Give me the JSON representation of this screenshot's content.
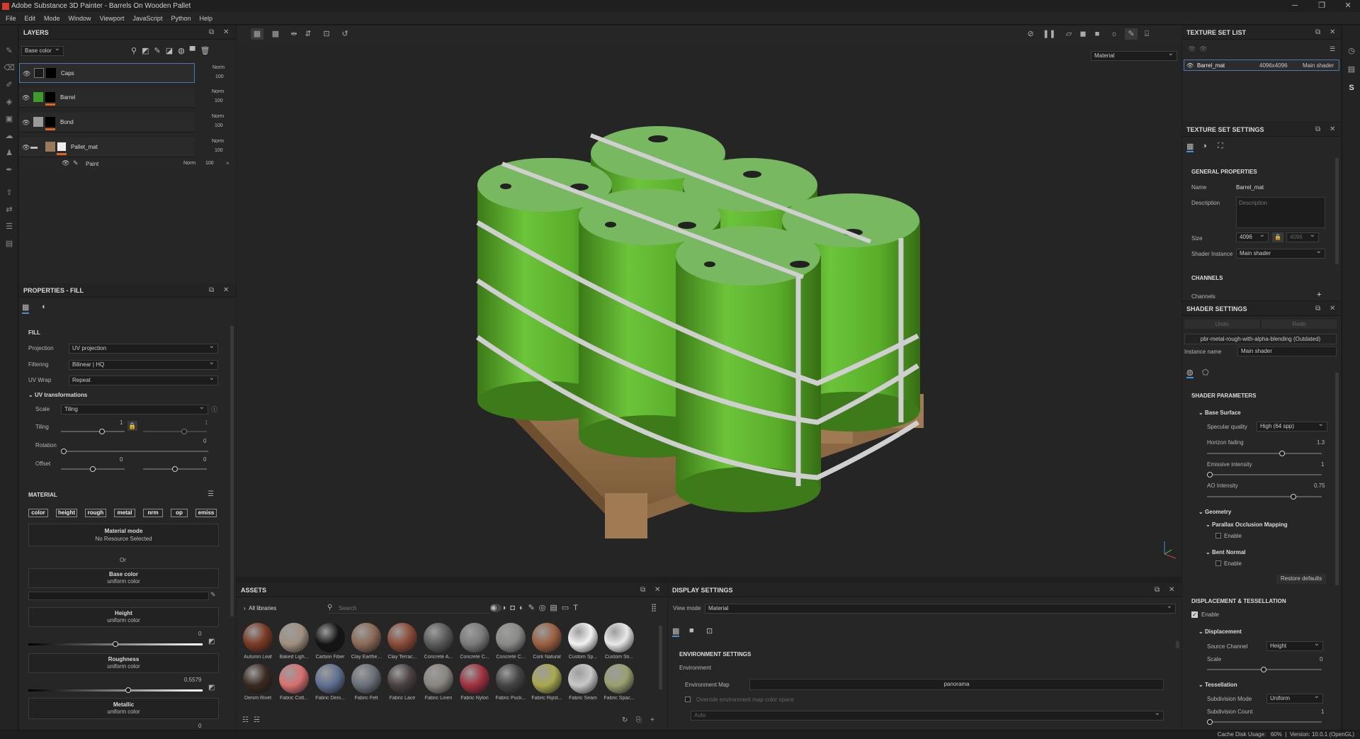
{
  "window": {
    "title": "Adobe Substance 3D Painter - Barrels On Wooden Pallet",
    "minimize": "─",
    "maximize": "❐",
    "close": "✕"
  },
  "menu": [
    "File",
    "Edit",
    "Mode",
    "Window",
    "Viewport",
    "JavaScript",
    "Python",
    "Help"
  ],
  "layers": {
    "title": "LAYERS",
    "channel": "Base color",
    "items": [
      {
        "name": "Caps",
        "blend": "Norm",
        "opacity": "100"
      },
      {
        "name": "Barrel",
        "blend": "Norm",
        "opacity": "100"
      },
      {
        "name": "Bond",
        "blend": "Norm",
        "opacity": "100"
      },
      {
        "name": "Pallet_mat",
        "blend": "Norm",
        "opacity": "100"
      }
    ],
    "sub": {
      "name": "Paint",
      "blend": "Norm",
      "opacity": "100"
    }
  },
  "properties": {
    "title": "PROPERTIES - FILL",
    "fill": "FILL",
    "projection_label": "Projection",
    "projection": "UV projection",
    "filtering_label": "Filtering",
    "filtering": "Bilinear | HQ",
    "uvwrap_label": "UV Wrap",
    "uvwrap": "Repeat",
    "uvt": "UV transformations",
    "scale_label": "Scale",
    "scale": "Tiling",
    "tiling_label": "Tiling",
    "tiling_val": "1",
    "tiling_val2": "1",
    "rotation_label": "Rotation",
    "rotation_val": "0",
    "offset_label": "Offset",
    "offset_val1": "0",
    "offset_val2": "0",
    "material": "MATERIAL",
    "chips": [
      "color",
      "height",
      "rough",
      "metal",
      "nrm",
      "op",
      "emiss"
    ],
    "mat_mode": "Material mode",
    "mat_mode_sub": "No Resource Selected",
    "or": "Or",
    "base_color": "Base color",
    "base_color_sub": "uniform color",
    "height": "Height",
    "height_sub": "uniform color",
    "height_val": "0",
    "roughness": "Roughness",
    "roughness_sub": "uniform color",
    "roughness_val": "0.5579",
    "metallic": "Metallic",
    "metallic_sub": "uniform color",
    "metallic_val": "0"
  },
  "viewport": {
    "mode": "Material"
  },
  "assets": {
    "title": "ASSETS",
    "libraries": "All libraries",
    "search_placeholder": "Search",
    "row1": [
      "Autumn Leaf",
      "Baked Ligh...",
      "Carbon Fiber",
      "Clay Earthe...",
      "Clay Terrac...",
      "Concrete A...",
      "Concrete C...",
      "Concrete C...",
      "Cork Natural",
      "Custom Sp...",
      "Custom Sti..."
    ],
    "row2": [
      "Denim Rivet",
      "Fabric Cott...",
      "Fabric Deni...",
      "Fabric Felt",
      "Fabric Lace",
      "Fabric Linen",
      "Fabric Nylon",
      "Fabric Puck...",
      "Fabric Ripst...",
      "Fabric Seam",
      "Fabric Spac..."
    ],
    "colors1": [
      "#7a3a22",
      "#a09080",
      "#151515",
      "#8a6a55",
      "#8a4a35",
      "#5a5a5a",
      "#7a7a7a",
      "#8a8a88",
      "#9a6040",
      "#f2f2f2",
      "#e8e8e8"
    ],
    "colors2": [
      "#3a2a20",
      "#d87070",
      "#607090",
      "#6a7078",
      "#4a4040",
      "#8a8580",
      "#a03040",
      "#444",
      "#a8a850",
      "#c8c8c8",
      "#9aa070"
    ]
  },
  "display": {
    "title": "DISPLAY SETTINGS",
    "view_mode_label": "View mode",
    "view_mode": "Material",
    "env_settings": "ENVIRONMENT SETTINGS",
    "environment": "Environment",
    "env_map_label": "Environment Map",
    "env_map": "panorama",
    "override": "Override environment map color space",
    "auto": "Auto"
  },
  "textureset_list": {
    "title": "TEXTURE SET LIST",
    "name": "Barrel_mat",
    "res": "4096x4096",
    "shader": "Main shader"
  },
  "textureset_settings": {
    "title": "TEXTURE SET SETTINGS",
    "general": "GENERAL PROPERTIES",
    "name_label": "Name",
    "name": "Barrel_mat",
    "desc_label": "Description",
    "desc_placeholder": "Description",
    "size_label": "Size",
    "size": "4096",
    "size2": "4096",
    "shader_inst_label": "Shader Instance",
    "shader_inst": "Main shader",
    "channels": "CHANNELS",
    "channels_label": "Channels"
  },
  "shader": {
    "title": "SHADER SETTINGS",
    "undo": "Undo",
    "redo": "Redo",
    "shader_name": "pbr-metal-rough-with-alpha-blending (Outdated)",
    "instance_label": "Instance name",
    "instance": "Main shader",
    "params": "SHADER PARAMETERS",
    "base_surface": "Base Surface",
    "spec_label": "Specular quality",
    "spec": "High (64 spp)",
    "horizon_label": "Horizon fading",
    "horizon_val": "1.3",
    "emissive_label": "Emissive intensity",
    "emissive_val": "1",
    "ao_label": "AO Intensity",
    "ao_val": "0.75",
    "geometry": "Geometry",
    "pom": "Parallax Occlusion Mapping",
    "enable": "Enable",
    "bent": "Bent Normal",
    "enable2": "Enable",
    "restore": "Restore defaults",
    "disp_tess": "DISPLACEMENT & TESSELLATION",
    "enable3": "Enable",
    "displacement": "Displacement",
    "source_label": "Source Channel",
    "source": "Height",
    "scale_label": "Scale",
    "scale_val": "0",
    "tessellation": "Tessellation",
    "subdiv_mode_label": "Subdivision Mode",
    "subdiv_mode": "Uniform",
    "subdiv_count_label": "Subdivision Count",
    "subdiv_count": "1"
  },
  "status": {
    "text": "Cache Disk Usage:   60%  |  Version: 10.0.1 (OpenGL)"
  }
}
